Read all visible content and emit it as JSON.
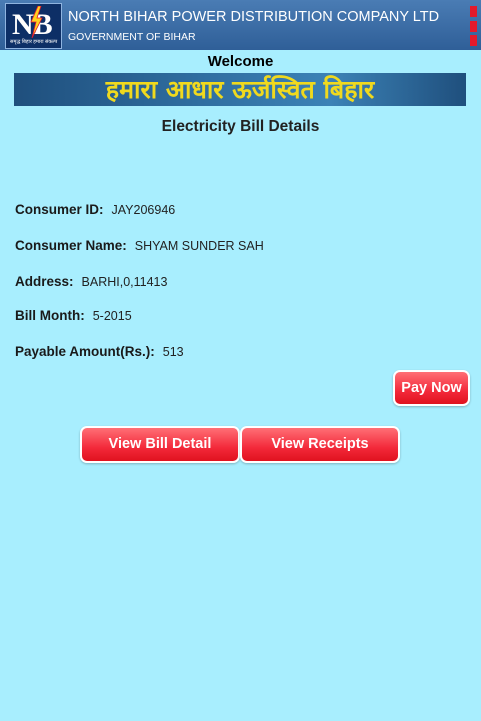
{
  "header": {
    "logo_text": "NB",
    "logo_tagline": "समृद्ध बिहार हमारा संकल्प",
    "company_name": "NORTH BIHAR POWER DISTRIBUTION COMPANY LTD",
    "government": "GOVERNMENT OF BIHAR"
  },
  "welcome": "Welcome",
  "banner_text": "हमारा आधार ऊर्जस्वित बिहार",
  "page_title": "Electricity Bill Details",
  "details": {
    "consumer_id": {
      "label": "Consumer ID:",
      "value": "JAY206946"
    },
    "consumer_name": {
      "label": "Consumer Name:",
      "value": "SHYAM SUNDER SAH"
    },
    "address": {
      "label": "Address:",
      "value": "BARHI,0,11413"
    },
    "bill_month": {
      "label": "Bill Month:",
      "value": "5-2015"
    },
    "payable_amount": {
      "label": "Payable Amount(Rs.):",
      "value": "513"
    }
  },
  "buttons": {
    "pay_now": "Pay Now",
    "view_bill_detail": "View Bill Detail",
    "view_receipts": "View Receipts"
  },
  "colors": {
    "background": "#a8eefe",
    "header": "#3d6fa7",
    "button": "#f3293a",
    "banner_text": "#f0d91e"
  },
  "icons": {
    "logo": "bolt-icon",
    "menu": "overflow-menu-icon"
  }
}
